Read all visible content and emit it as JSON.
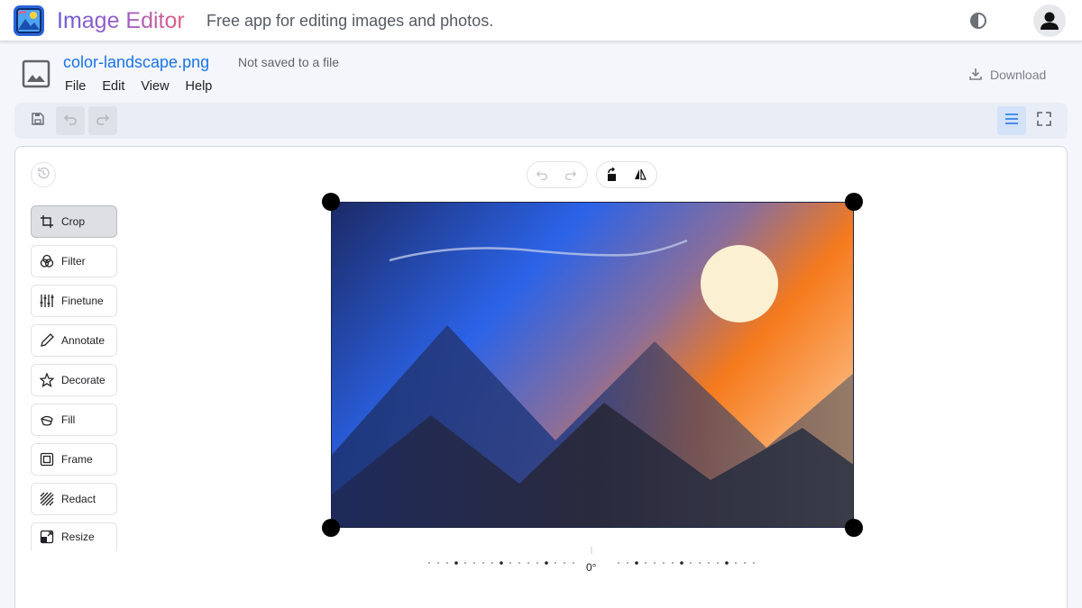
{
  "app": {
    "title": "Image Editor",
    "subtitle": "Free app for editing images and photos.",
    "logo_icon": "app-logo-icon",
    "theme_icon": "contrast-icon",
    "account_icon": "account-icon"
  },
  "file": {
    "name": "color-landscape.png",
    "status": "Not saved to a file",
    "icon": "image-icon"
  },
  "menu": {
    "file": "File",
    "edit": "Edit",
    "view": "View",
    "help": "Help"
  },
  "download": {
    "label": "Download",
    "icon": "download-icon"
  },
  "toolbar": {
    "save_icon": "save-icon",
    "undo_icon": "undo-icon",
    "redo_icon": "redo-icon",
    "list_view_icon": "menu-lines-icon",
    "fullscreen_icon": "fullscreen-icon"
  },
  "tools": [
    {
      "label": "Crop",
      "icon": "crop-icon",
      "active": true
    },
    {
      "label": "Filter",
      "icon": "filter-icon",
      "active": false
    },
    {
      "label": "Finetune",
      "icon": "sliders-icon",
      "active": false
    },
    {
      "label": "Annotate",
      "icon": "pencil-icon",
      "active": false
    },
    {
      "label": "Decorate",
      "icon": "star-icon",
      "active": false
    },
    {
      "label": "Fill",
      "icon": "fill-bucket-icon",
      "active": false
    },
    {
      "label": "Frame",
      "icon": "frame-icon",
      "active": false
    },
    {
      "label": "Redact",
      "icon": "redact-icon",
      "active": false
    },
    {
      "label": "Resize",
      "icon": "resize-icon",
      "active": false
    }
  ],
  "crop": {
    "rotation": "0°",
    "rotate_icon": "rotate-left-icon",
    "flip_icon": "flip-horizontal-icon"
  },
  "colors": {
    "accent": "#1a73e8",
    "toolbar_bg": "#e9edf5",
    "active_tool": "#dedfe2",
    "sky_dark": "#1d2f6f",
    "sky_blue": "#2b63e8",
    "sunset_orange": "#f57a1c",
    "sun": "#fbf0d2"
  }
}
